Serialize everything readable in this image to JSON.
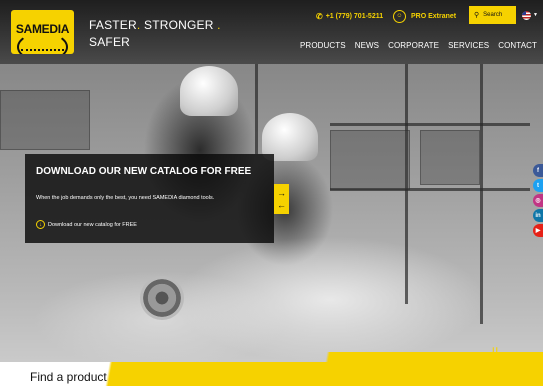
{
  "brand": {
    "logo_text": "SAMEDIA",
    "tagline_line1_a": "FASTER",
    "tagline_line1_b": "STRONGER",
    "tagline_line2": "SAFER",
    "accent_color": "#f6d200"
  },
  "utility": {
    "phone": "+1 (779) 701-5211",
    "pro_label": "PRO Extranet",
    "search_label": "Search",
    "language_icon": "us-flag-icon"
  },
  "nav": {
    "items": [
      "PRODUCTS",
      "NEWS",
      "CORPORATE",
      "SERVICES",
      "CONTACT"
    ]
  },
  "hero": {
    "title": "DOWNLOAD OUR NEW CATALOG FOR FREE",
    "text": "When the job demands only the best, you need SAMEDIA diamond tools.",
    "link": "Download our new catalog for FREE"
  },
  "social": {
    "icons": [
      "facebook-icon",
      "twitter-icon",
      "instagram-icon",
      "linkedin-icon",
      "youtube-icon"
    ]
  },
  "footer": {
    "find_product": "Find a product"
  }
}
